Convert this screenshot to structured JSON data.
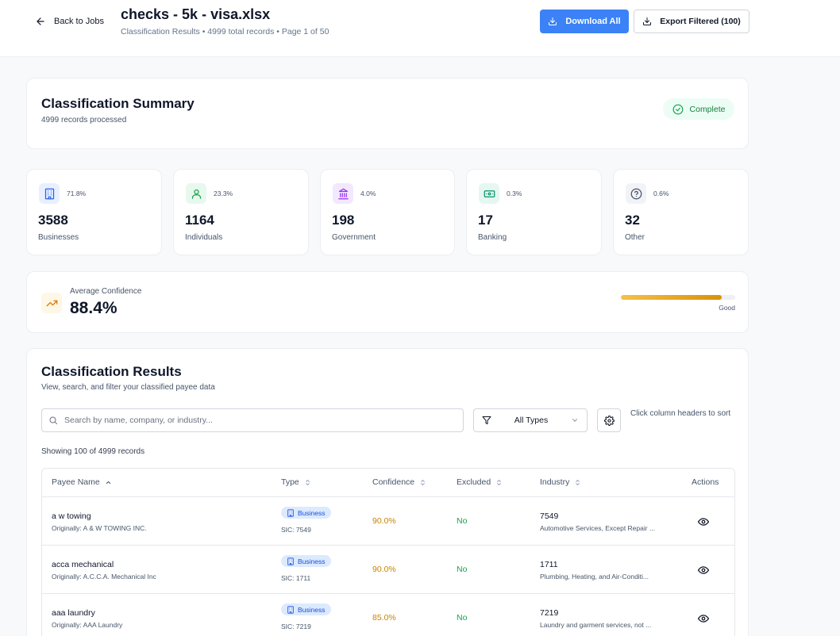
{
  "header": {
    "back_label": "Back to Jobs",
    "title": "checks - 5k - visa.xlsx",
    "subtitle": "Classification Results • 4999 total records • Page 1 of 50",
    "download_all": "Download All",
    "export_filtered": "Export Filtered (100)"
  },
  "summary": {
    "title": "Classification Summary",
    "subtitle": "4999 records processed",
    "status": "Complete"
  },
  "stats": [
    {
      "pct": "71.8%",
      "value": "3588",
      "label": "Businesses",
      "icon": "building-icon",
      "color": "#2563eb",
      "bg": "#e8efff"
    },
    {
      "pct": "23.3%",
      "value": "1164",
      "label": "Individuals",
      "icon": "user-icon",
      "color": "#16a34a",
      "bg": "#e8f8ee"
    },
    {
      "pct": "4.0%",
      "value": "198",
      "label": "Government",
      "icon": "landmark-icon",
      "color": "#9333ea",
      "bg": "#f3e8ff"
    },
    {
      "pct": "0.3%",
      "value": "17",
      "label": "Banking",
      "icon": "banknote-icon",
      "color": "#059669",
      "bg": "#e6f7f1"
    },
    {
      "pct": "0.6%",
      "value": "32",
      "label": "Other",
      "icon": "help-circle-icon",
      "color": "#475569",
      "bg": "#f1f3f6"
    }
  ],
  "confidence": {
    "label": "Average Confidence",
    "value": "88.4%",
    "level": 0.884,
    "rating": "Good"
  },
  "results": {
    "title": "Classification Results",
    "subtitle": "View, search, and filter your classified payee data",
    "search_placeholder": "Search by name, company, or industry...",
    "type_filter": "All Types",
    "sort_hint": "Click column headers to sort",
    "showing": "Showing 100 of 4999 records",
    "columns": [
      "Payee Name",
      "Type",
      "Confidence",
      "Excluded",
      "Industry",
      "Actions"
    ],
    "rows": [
      {
        "name": "a w towing",
        "original": "Originally: A & W TOWING INC.",
        "type": "Business",
        "sic": "SIC: 7549",
        "confidence": "90.0%",
        "excluded": "No",
        "industry_code": "7549",
        "industry_desc": "Automotive Services, Except Repair ..."
      },
      {
        "name": "acca mechanical",
        "original": "Originally: A.C.C.A. Mechanical Inc",
        "type": "Business",
        "sic": "SIC: 1711",
        "confidence": "90.0%",
        "excluded": "No",
        "industry_code": "1711",
        "industry_desc": "Plumbing, Heating, and Air-Conditi..."
      },
      {
        "name": "aaa laundry",
        "original": "Originally: AAA Laundry",
        "type": "Business",
        "sic": "SIC: 7219",
        "confidence": "85.0%",
        "excluded": "No",
        "industry_code": "7219",
        "industry_desc": "Laundry and garment services, not ..."
      }
    ]
  }
}
